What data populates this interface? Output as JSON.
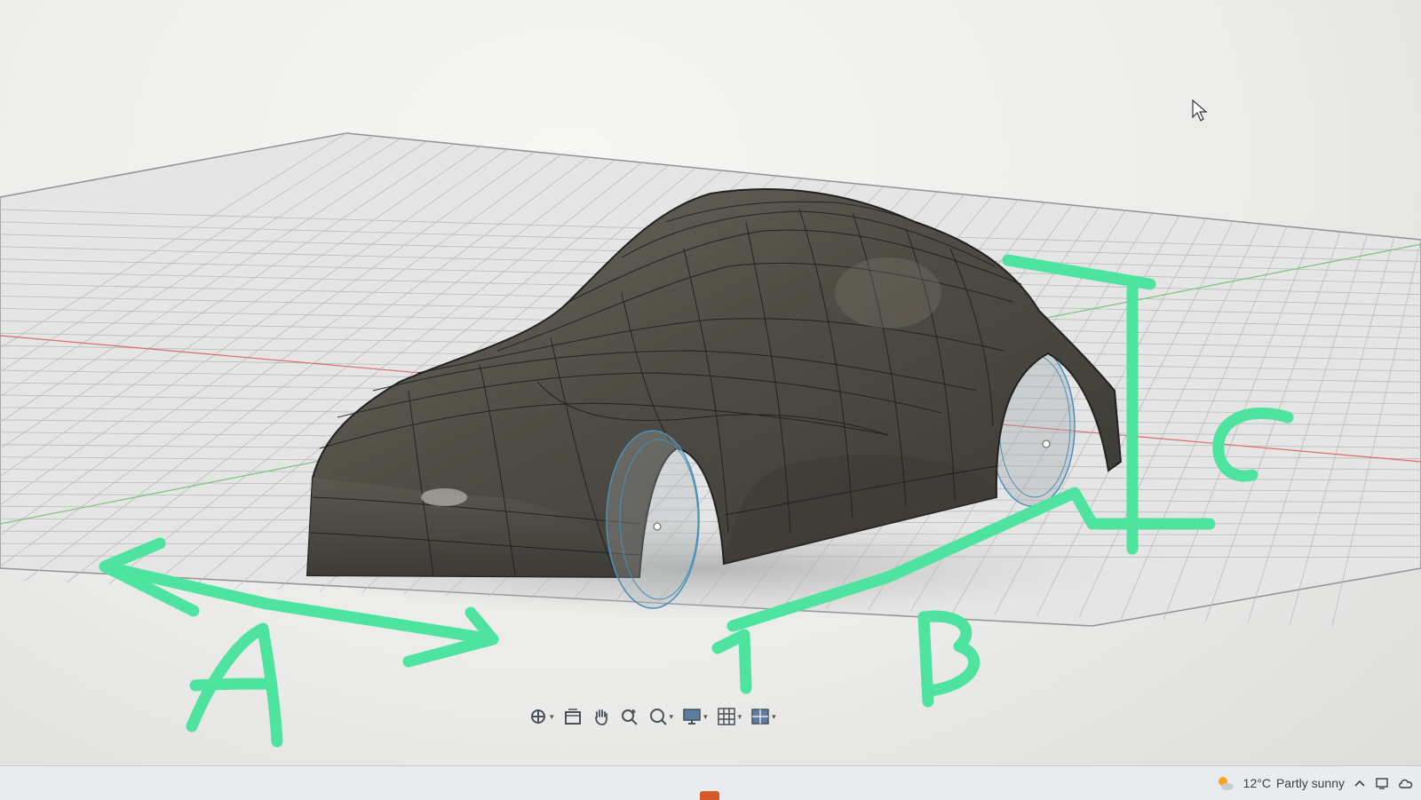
{
  "annotations": {
    "color": "#4fe3a0",
    "labels": {
      "a": "A",
      "b": "B",
      "c": "C"
    }
  },
  "viewport": {
    "background": "#ececea",
    "grid_color": "#b9bcbf",
    "axis_x_color": "#e06a6a",
    "axis_y_color": "#7bc47b",
    "car_body_color": "#57544a",
    "wheel_color": "#4a90b8"
  },
  "toolbar": {
    "buttons": [
      {
        "name": "orbit",
        "icon": "orbit-icon",
        "has_dropdown": true
      },
      {
        "name": "look-at",
        "icon": "look-at-icon",
        "has_dropdown": false
      },
      {
        "name": "pan",
        "icon": "hand-icon",
        "has_dropdown": false
      },
      {
        "name": "zoom",
        "icon": "zoom-icon",
        "has_dropdown": false
      },
      {
        "name": "fit",
        "icon": "zoom-window-icon",
        "has_dropdown": true
      },
      {
        "name": "display-settings",
        "icon": "display-icon",
        "has_dropdown": true
      },
      {
        "name": "grid-settings",
        "icon": "grid-icon",
        "has_dropdown": true
      },
      {
        "name": "viewports",
        "icon": "viewports-icon",
        "has_dropdown": true
      }
    ]
  },
  "taskbar": {
    "weather": {
      "icon": "partly-sunny-icon",
      "temperature": "12°C",
      "condition": "Partly sunny"
    },
    "tray_icons": [
      "chevron-up-icon",
      "network-icon",
      "cloud-icon"
    ]
  }
}
